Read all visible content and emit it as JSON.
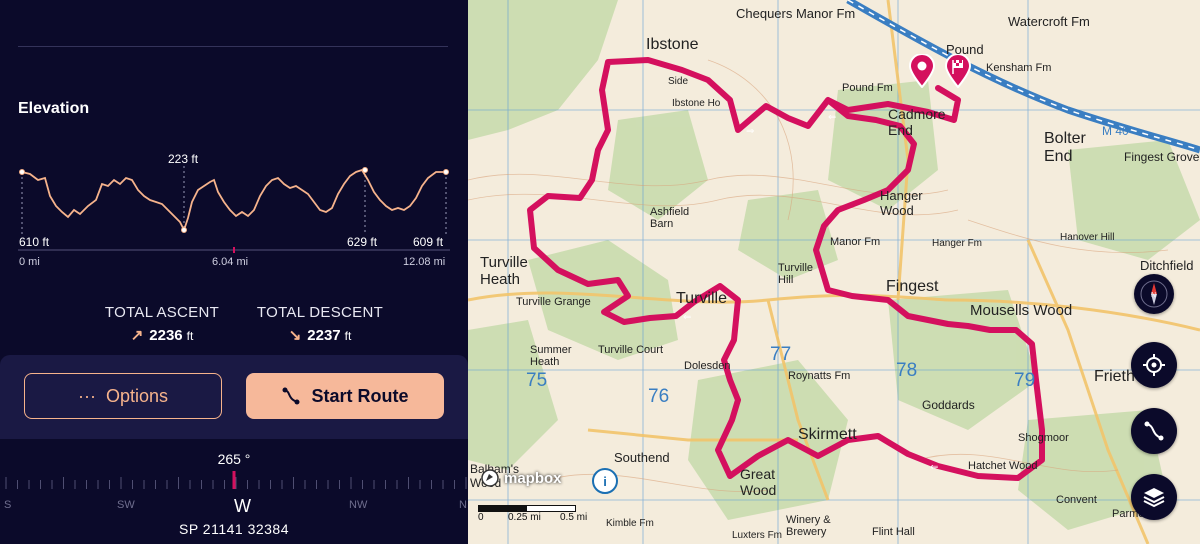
{
  "elevation": {
    "title": "Elevation",
    "peak_label": "223 ft",
    "left_label": "610 ft",
    "right_mid_label": "629 ft",
    "right_label": "609 ft",
    "x_start": "0 mi",
    "x_mid": "6.04 mi",
    "x_end": "12.08 mi",
    "line_color": "#f6b38c"
  },
  "stats": {
    "ascent_label": "TOTAL ASCENT",
    "ascent_value": "2236",
    "ascent_unit": "ft",
    "descent_label": "TOTAL DESCENT",
    "descent_value": "2237",
    "descent_unit": "ft"
  },
  "actions": {
    "options_label": "Options",
    "start_label": "Start Route"
  },
  "compass": {
    "heading": "265 °",
    "labels": [
      "S",
      "SW",
      "W",
      "NW",
      "N"
    ],
    "grid_ref": "SP 21141 32384"
  },
  "map": {
    "place_names": [
      "Ibstone",
      "Chequers Manor Fm",
      "Watercroft Fm",
      "Pound",
      "Kensham Fm",
      "Pound Fm",
      "Bolter End",
      "Fingest Grove",
      "Ashfield Barn",
      "Hanger Wood",
      "Manor Fm",
      "Turville Heath",
      "Turville Grange",
      "Turville",
      "Turville Court",
      "Turville Hill",
      "Fingest",
      "Mousells Wood",
      "Frieth",
      "Ditchfield",
      "Skirmett",
      "Goddards",
      "Southend",
      "Great Wood",
      "Dolesden",
      "Roynatts Fm",
      "Hatchet Wood",
      "Shogmoor",
      "Convent",
      "Parmoor",
      "Flint Hall",
      "Winery & Brewery",
      "Kimble Fm",
      "Luxters Fm",
      "Hanover Hill",
      "Hanger Fm",
      "Ibstone Ho",
      "Side",
      "Cadmore End",
      "M 40",
      "Summer Heath",
      "Balham's Wood"
    ],
    "grid_numbers": [
      "75",
      "76",
      "77",
      "78",
      "79"
    ],
    "attribution": "mapbox",
    "scale": [
      "0",
      "0.25 mi",
      "0.5 mi"
    ],
    "route_color": "#d4105e"
  },
  "map_controls": [
    "compass-icon",
    "locate-icon",
    "route-icon",
    "layers-icon"
  ]
}
